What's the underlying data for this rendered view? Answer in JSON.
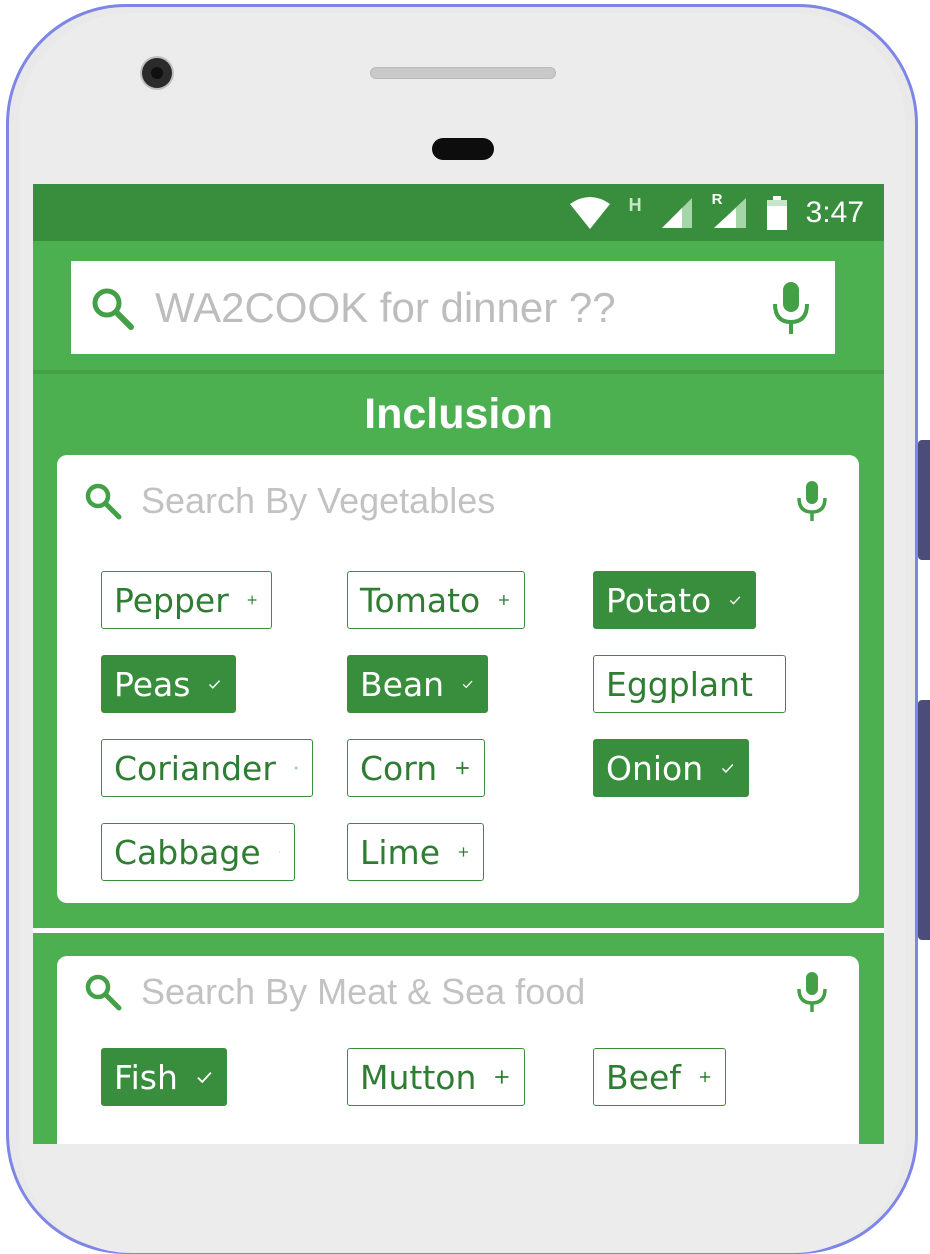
{
  "status_bar": {
    "time": "3:47",
    "network_letter": "H",
    "roaming_letter": "R"
  },
  "search": {
    "placeholder": "WA2COOK for dinner ??"
  },
  "section": {
    "title": "Inclusion"
  },
  "vegetables": {
    "placeholder": "Search By Vegetables",
    "chips": [
      {
        "label": "Pepper",
        "selected": false
      },
      {
        "label": "Tomato",
        "selected": false
      },
      {
        "label": "Potato",
        "selected": true
      },
      {
        "label": "Peas",
        "selected": true
      },
      {
        "label": "Bean",
        "selected": true
      },
      {
        "label": "Eggplant",
        "selected": false
      },
      {
        "label": "Coriander",
        "selected": false
      },
      {
        "label": "Corn",
        "selected": false
      },
      {
        "label": "Onion",
        "selected": true
      },
      {
        "label": "Cabbage",
        "selected": false
      },
      {
        "label": "Lime",
        "selected": false
      }
    ]
  },
  "meat": {
    "placeholder": "Search By Meat & Sea food",
    "chips": [
      {
        "label": "Fish",
        "selected": true
      },
      {
        "label": "Mutton",
        "selected": false
      },
      {
        "label": "Beef",
        "selected": false
      }
    ]
  },
  "colors": {
    "primary": "#4caf50",
    "primary_dark": "#388e3c",
    "chip_text": "#2e7d32"
  },
  "icons": {
    "search": "search-icon",
    "mic": "mic-icon",
    "add": "plus-icon",
    "selected": "check-icon"
  }
}
